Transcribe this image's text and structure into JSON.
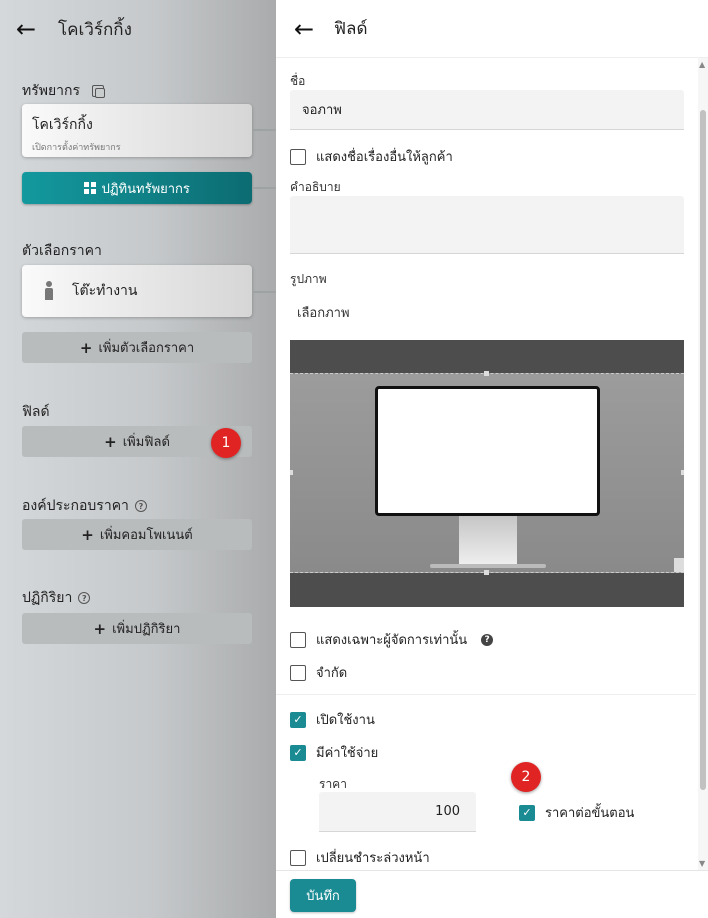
{
  "left": {
    "title": "โคเวิร์กกิ้ง",
    "resources_label": "ทรัพยากร",
    "resource_card": {
      "title": "โคเวิร์กกิ้ง",
      "subtitle": "เปิดการตั้งค่าทรัพยากร"
    },
    "calendar_button": "ปฏิทินทรัพยากร",
    "price_options_label": "ตัวเลือกราคา",
    "price_option_card": "โต๊ะทำงาน",
    "add_price_option": "เพิ่มตัวเลือกราคา",
    "fields_label": "ฟิลด์",
    "add_field": "เพิ่มฟิลด์",
    "badge_1": "1",
    "price_components_label": "องค์ประกอบราคา",
    "add_component": "เพิ่มคอมโพเนนต์",
    "actions_label": "ปฏิกิริยา",
    "add_action": "เพิ่มปฏิกิริยา"
  },
  "right": {
    "title": "ฟิลด์",
    "name_label": "ชื่อ",
    "name_value": "จอภาพ",
    "show_other_name": "แสดงชื่อเรื่องอื่นให้ลูกค้า",
    "description_label": "คำอธิบาย",
    "description_value": "",
    "image_label": "รูปภาพ",
    "choose_image": "เลือกภาพ",
    "admin_only": "แสดงเฉพาะผู้จัดการเท่านั้น",
    "limited": "จำกัด",
    "enabled": "เปิดใช้งาน",
    "has_cost": "มีค่าใช้จ่าย",
    "price_label": "ราคา",
    "price_value": "100",
    "price_per_step": "ราคาต่อขั้นตอน",
    "badge_2": "2",
    "change_prepay": "เปลี่ยนชำระล่วงหน้า",
    "save": "บันทึก"
  },
  "checkbox_states": {
    "show_other_name": false,
    "admin_only": false,
    "limited": false,
    "enabled": true,
    "has_cost": true,
    "price_per_step": true,
    "change_prepay": false
  },
  "colors": {
    "accent": "#1a8a93",
    "badge": "#e02424"
  },
  "icons": [
    "back-arrow-icon",
    "copy-icon",
    "grid-icon",
    "person-icon",
    "plus-icon",
    "help-icon",
    "question-icon",
    "checkmark-icon"
  ]
}
